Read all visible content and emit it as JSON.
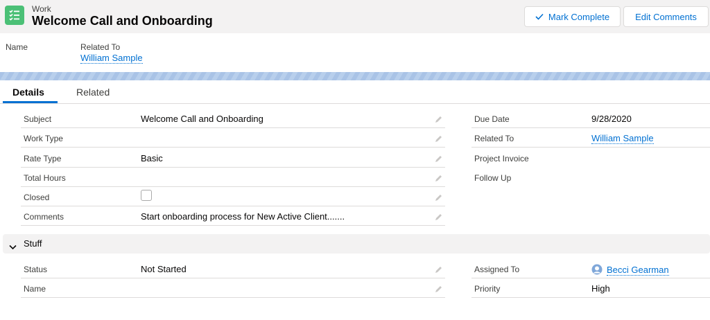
{
  "header": {
    "object_type": "Work",
    "record_title": "Welcome Call and Onboarding",
    "icon": "task-list-icon",
    "buttons": {
      "mark_complete": "Mark Complete",
      "edit_comments": "Edit Comments"
    }
  },
  "highlights": {
    "name_label": "Name",
    "related_to_label": "Related To",
    "related_to_value": "William Sample"
  },
  "tabs": [
    {
      "label": "Details",
      "active": true
    },
    {
      "label": "Related",
      "active": false
    }
  ],
  "details": {
    "left": [
      {
        "label": "Subject",
        "value": "Welcome Call and Onboarding"
      },
      {
        "label": "Work Type",
        "value": ""
      },
      {
        "label": "Rate Type",
        "value": "Basic"
      },
      {
        "label": "Total Hours",
        "value": ""
      },
      {
        "label": "Closed",
        "value": ""
      },
      {
        "label": "Comments",
        "value": "Start onboarding process for New Active Client......."
      }
    ],
    "right": [
      {
        "label": "Due Date",
        "value": "9/28/2020"
      },
      {
        "label": "Related To",
        "value": "William Sample"
      },
      {
        "label": "Project Invoice",
        "value": ""
      },
      {
        "label": "Follow Up",
        "value": ""
      }
    ],
    "closed_checked": false
  },
  "section": {
    "title": "Stuff",
    "left": [
      {
        "label": "Status",
        "value": "Not Started"
      },
      {
        "label": "Name",
        "value": ""
      }
    ],
    "right": [
      {
        "label": "Assigned To",
        "value": "Becci Gearman"
      },
      {
        "label": "Priority",
        "value": "High"
      }
    ]
  },
  "colors": {
    "accent": "#0070d2",
    "object_icon": "#4bc076",
    "header_bg": "#f3f2f2"
  }
}
